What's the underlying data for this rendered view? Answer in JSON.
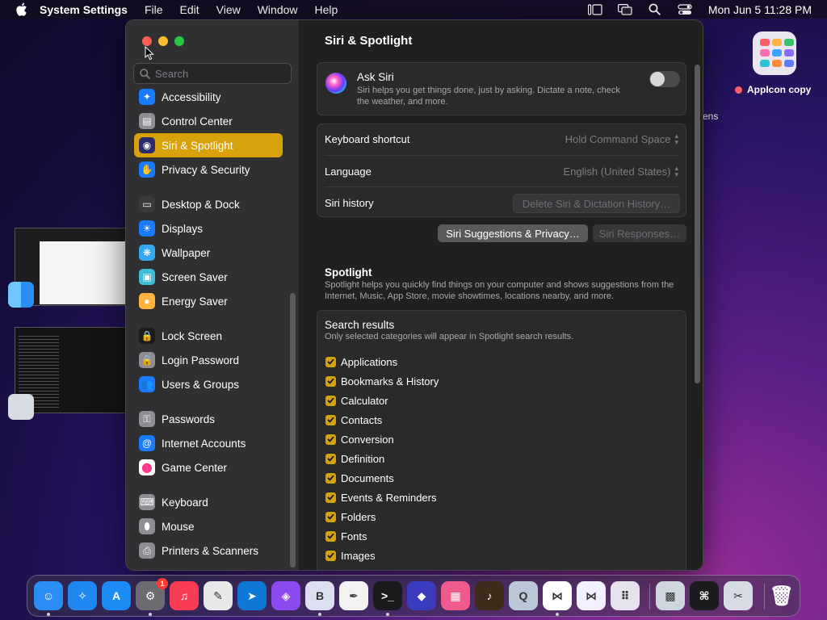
{
  "menubar": {
    "app": "System Settings",
    "menus": [
      "File",
      "Edit",
      "View",
      "Window",
      "Help"
    ],
    "clock": "Mon Jun 5  11:28 PM",
    "status_icons": [
      "stage-manager-icon",
      "screen-mirroring-icon",
      "spotlight-search-icon",
      "control-center-icon"
    ]
  },
  "desktop": {
    "icon_label": "AppIcon copy",
    "partial_label": "ens"
  },
  "window": {
    "search_placeholder": "Search",
    "traffic_colors": {
      "close": "#ff5f57",
      "minimize": "#febc2e",
      "zoom": "#28c840"
    },
    "sidebar": [
      {
        "label": "Accessibility",
        "icon": "accessibility-icon",
        "color": "#1a7bff",
        "glyph": "✦"
      },
      {
        "label": "Control Center",
        "icon": "control-center-icon",
        "color": "#8e8e93",
        "glyph": "▤"
      },
      {
        "label": "Siri & Spotlight",
        "icon": "siri-icon",
        "color": "#2b2b6e",
        "glyph": "◉",
        "selected": true
      },
      {
        "label": "Privacy & Security",
        "icon": "hand-icon",
        "color": "#1a7bff",
        "glyph": "✋"
      },
      {
        "gap": true
      },
      {
        "label": "Desktop & Dock",
        "icon": "dock-icon",
        "color": "#3a3a3c",
        "glyph": "▭"
      },
      {
        "label": "Displays",
        "icon": "display-icon",
        "color": "#1a7bff",
        "glyph": "☀"
      },
      {
        "label": "Wallpaper",
        "icon": "wallpaper-icon",
        "color": "#35a9f0",
        "glyph": "❋"
      },
      {
        "label": "Screen Saver",
        "icon": "screen-saver-icon",
        "color": "#3dbdd6",
        "glyph": "▣"
      },
      {
        "label": "Energy Saver",
        "icon": "energy-icon",
        "color": "#ffb340",
        "glyph": "●"
      },
      {
        "gap": true
      },
      {
        "label": "Lock Screen",
        "icon": "lock-icon",
        "color": "#1c1c1e",
        "glyph": "🔒"
      },
      {
        "label": "Login Password",
        "icon": "password-lock-icon",
        "color": "#8e8e93",
        "glyph": "🔒"
      },
      {
        "label": "Users & Groups",
        "icon": "users-icon",
        "color": "#1a7bff",
        "glyph": "👥"
      },
      {
        "gap": true
      },
      {
        "label": "Passwords",
        "icon": "key-icon",
        "color": "#8e8e93",
        "glyph": "⚿"
      },
      {
        "label": "Internet Accounts",
        "icon": "at-icon",
        "color": "#1a7bff",
        "glyph": "@"
      },
      {
        "label": "Game Center",
        "icon": "game-center-icon",
        "color": "#ffffff",
        "glyph": "⬤"
      },
      {
        "gap": true
      },
      {
        "label": "Keyboard",
        "icon": "keyboard-icon",
        "color": "#8e8e93",
        "glyph": "⌨"
      },
      {
        "label": "Mouse",
        "icon": "mouse-icon",
        "color": "#8e8e93",
        "glyph": "⬮"
      },
      {
        "label": "Printers & Scanners",
        "icon": "printer-icon",
        "color": "#8e8e93",
        "glyph": "⎙"
      }
    ],
    "content": {
      "title": "Siri & Spotlight",
      "ask_siri": {
        "title": "Ask Siri",
        "description": "Siri helps you get things done, just by asking. Dictate a note, check the weather, and more.",
        "enabled": false
      },
      "settings": [
        {
          "label": "Keyboard shortcut",
          "value": "Hold Command Space"
        },
        {
          "label": "Language",
          "value": "English (United States)"
        },
        {
          "label": "Siri history",
          "button": "Delete Siri & Dictation History…"
        }
      ],
      "buttons": {
        "suggestions": "Siri Suggestions & Privacy…",
        "responses": "Siri Responses…"
      },
      "spotlight": {
        "title": "Spotlight",
        "description": "Spotlight helps you quickly find things on your computer and shows suggestions from the Internet, Music, App Store, movie showtimes, locations nearby, and more.",
        "results_title": "Search results",
        "results_desc": "Only selected categories will appear in Spotlight search results.",
        "categories": [
          "Applications",
          "Bookmarks & History",
          "Calculator",
          "Contacts",
          "Conversion",
          "Definition",
          "Documents",
          "Events & Reminders",
          "Folders",
          "Fonts",
          "Images"
        ]
      }
    }
  },
  "dock": {
    "badge": "1",
    "apps": [
      {
        "name": "finder-icon",
        "bg": "#2a8ef5",
        "glyph": "☺",
        "running": true
      },
      {
        "name": "safari-icon",
        "bg": "#1f88f0",
        "glyph": "✧",
        "running": false
      },
      {
        "name": "app-store-icon",
        "bg": "#1b8cf5",
        "glyph": "A",
        "running": false
      },
      {
        "name": "system-settings-icon",
        "bg": "#6c6c70",
        "glyph": "⚙",
        "running": true,
        "badge": true
      },
      {
        "name": "music-icon",
        "bg": "#fa3d55",
        "glyph": "♫",
        "running": false
      },
      {
        "name": "script-editor-icon",
        "bg": "#e8e8ea",
        "glyph": "✎",
        "running": false
      },
      {
        "name": "xcode-instruments-icon",
        "bg": "#0f78d6",
        "glyph": "➤",
        "running": false
      },
      {
        "name": "podcast-icon",
        "bg": "#8c4af0",
        "glyph": "◈",
        "running": false
      },
      {
        "name": "bbedit-icon",
        "bg": "#dcdff2",
        "glyph": "B",
        "running": true
      },
      {
        "name": "textedit-icon",
        "bg": "#f2f2f2",
        "glyph": "✒",
        "running": false
      },
      {
        "name": "terminal-icon",
        "bg": "#1b1b1d",
        "glyph": ">_",
        "running": true
      },
      {
        "name": "shortcuts-icon",
        "bg": "#3b3bbf",
        "glyph": "◆",
        "running": false
      },
      {
        "name": "preview-icon",
        "bg": "#f05a8c",
        "glyph": "▦",
        "running": false
      },
      {
        "name": "garageband-icon",
        "bg": "#3d2b1c",
        "glyph": "♪",
        "running": false
      },
      {
        "name": "quicktime-icon",
        "bg": "#b9c7d6",
        "glyph": "Q",
        "running": false
      },
      {
        "name": "vscode-icon",
        "bg": "#ffffff",
        "glyph": "⋈",
        "running": true
      },
      {
        "name": "visual-studio-icon",
        "bg": "#f3f0ff",
        "glyph": "⋈",
        "running": false
      },
      {
        "name": "launchpad-icon",
        "bg": "#e6e2ec",
        "glyph": "⠿",
        "running": false
      },
      {
        "name": "image-capture-icon",
        "bg": "#cfd6df",
        "glyph": "▩",
        "running": false
      },
      {
        "name": "keyboard-viewer-icon",
        "bg": "#1b1b1d",
        "glyph": "⌘",
        "running": false
      },
      {
        "name": "system-tool-icon",
        "bg": "#d7dbe3",
        "glyph": "✂",
        "running": false
      },
      {
        "name": "trash-icon",
        "bg": "transparent",
        "glyph": "🗑",
        "running": false
      }
    ]
  }
}
